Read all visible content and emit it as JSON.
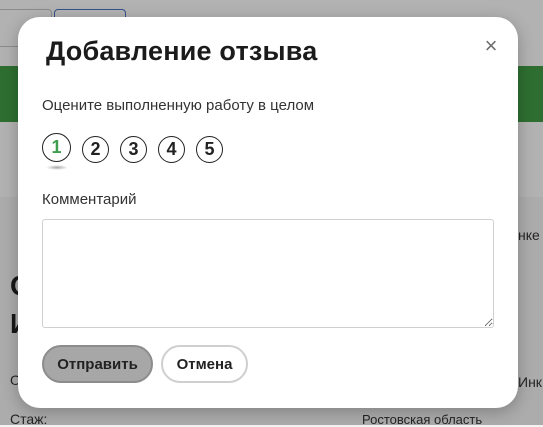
{
  "background": {
    "snippet_right_1": "нке",
    "snippet_right_2": "Инк",
    "snippet_left_1": "О",
    "snippet_big": "И",
    "snippet_big_2": "О",
    "stazh_label": "Стаж:",
    "region": "Ростовская область"
  },
  "modal": {
    "title": "Добавление отзыва",
    "close_symbol": "×",
    "rating_prompt": "Оцените выполненную работу в целом",
    "rating": {
      "options": [
        "1",
        "2",
        "3",
        "4",
        "5"
      ],
      "selected": "1"
    },
    "comment_label": "Комментарий",
    "comment_value": "",
    "submit_label": "Отправить",
    "cancel_label": "Отмена"
  },
  "colors": {
    "accent_green": "#43a047",
    "selected_rating_text": "#3f9d4e",
    "submit_bg": "#a7a7a7"
  }
}
